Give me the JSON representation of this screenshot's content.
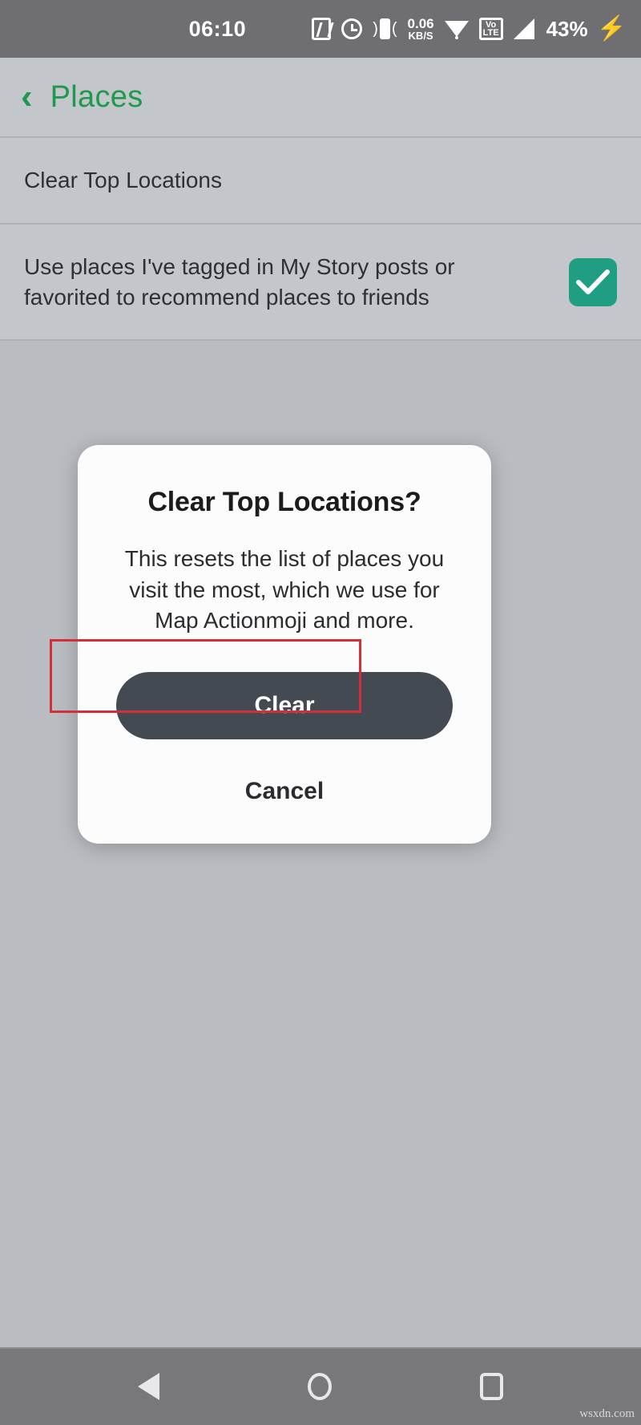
{
  "status_bar": {
    "time": "06:10",
    "network_speed_value": "0.06",
    "network_speed_unit": "KB/S",
    "volte_top": "Vo",
    "volte_bottom": "LTE",
    "battery_percent": "43%",
    "icons": [
      "nfc-icon",
      "alarm-icon",
      "vibrate-icon",
      "network-speed-icon",
      "wifi-icon",
      "volte-icon",
      "signal-icon",
      "battery-icon",
      "charging-bolt-icon"
    ],
    "background_color": "#6e6e73"
  },
  "header": {
    "back_label": "‹",
    "title": "Places",
    "accent_color": "#1f9a4d"
  },
  "settings_rows": [
    {
      "label": "Clear Top Locations",
      "has_checkbox": false
    },
    {
      "label_line1": "Use places I've tagged in My Story posts or",
      "label_line2": "favorited to recommend places to friends",
      "has_checkbox": true,
      "checked": true,
      "checkbox_color": "#1f9e84"
    }
  ],
  "dialog": {
    "title": "Clear Top Locations?",
    "body_line1": "This resets the list of places you",
    "body_line2": "visit the most, which we use for",
    "body_line3": "Map Actionmoji and more.",
    "primary_button": "Clear",
    "primary_button_color": "#434a52",
    "secondary_button": "Cancel",
    "background_color": "#fcfcfc"
  },
  "annotation": {
    "type": "highlight-rectangle",
    "target": "Clear",
    "color": "#d32f3a"
  },
  "nav_bar": {
    "buttons": [
      "back-nav-button",
      "home-nav-button",
      "recents-nav-button"
    ],
    "background_color": "#77777c"
  },
  "watermark": {
    "text": "wsxdn.com"
  }
}
